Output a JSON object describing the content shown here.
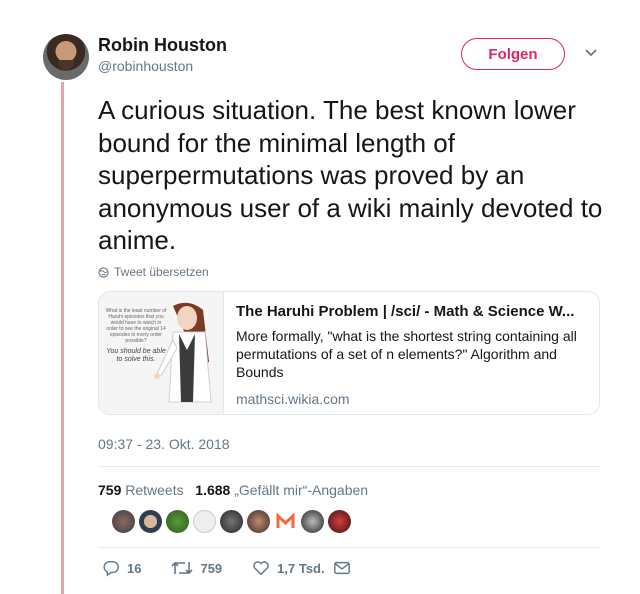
{
  "author": {
    "name": "Robin Houston",
    "handle": "@robinhouston"
  },
  "follow_label": "Folgen",
  "tweet_text": "A curious situation. The best known lower bound for the minimal length of superpermutations was proved by an anonymous user of a wiki mainly devoted to anime.",
  "translate_label": "Tweet übersetzen",
  "card": {
    "image_text": "What is the least number of Haruhi episodes that you would have to watch in order to see the original 14 episodes in every order possible?",
    "image_script": "You should be able to solve this.",
    "title": "The Haruhi Problem | /sci/ - Math & Science W...",
    "description": "More formally, \"what is the shortest string containing all permutations of a set of n elements?\" Algorithm and Bounds",
    "domain": "mathsci.wikia.com"
  },
  "timestamp": "09:37 - 23. Okt. 2018",
  "stats": {
    "retweets_count": "759",
    "retweets_label": "Retweets",
    "likes_count": "1.688",
    "likes_label": "„Gefällt mir“-Angaben"
  },
  "actions": {
    "replies": "16",
    "retweets": "759",
    "likes": "1,7 Tsd."
  },
  "colors": {
    "accent": "#e0245e",
    "muted": "#657786",
    "thread_line": "#e8a1ad"
  },
  "icons": [
    "chevron-down-icon",
    "globe-icon",
    "reply-icon",
    "retweet-icon",
    "heart-icon",
    "mail-icon"
  ]
}
